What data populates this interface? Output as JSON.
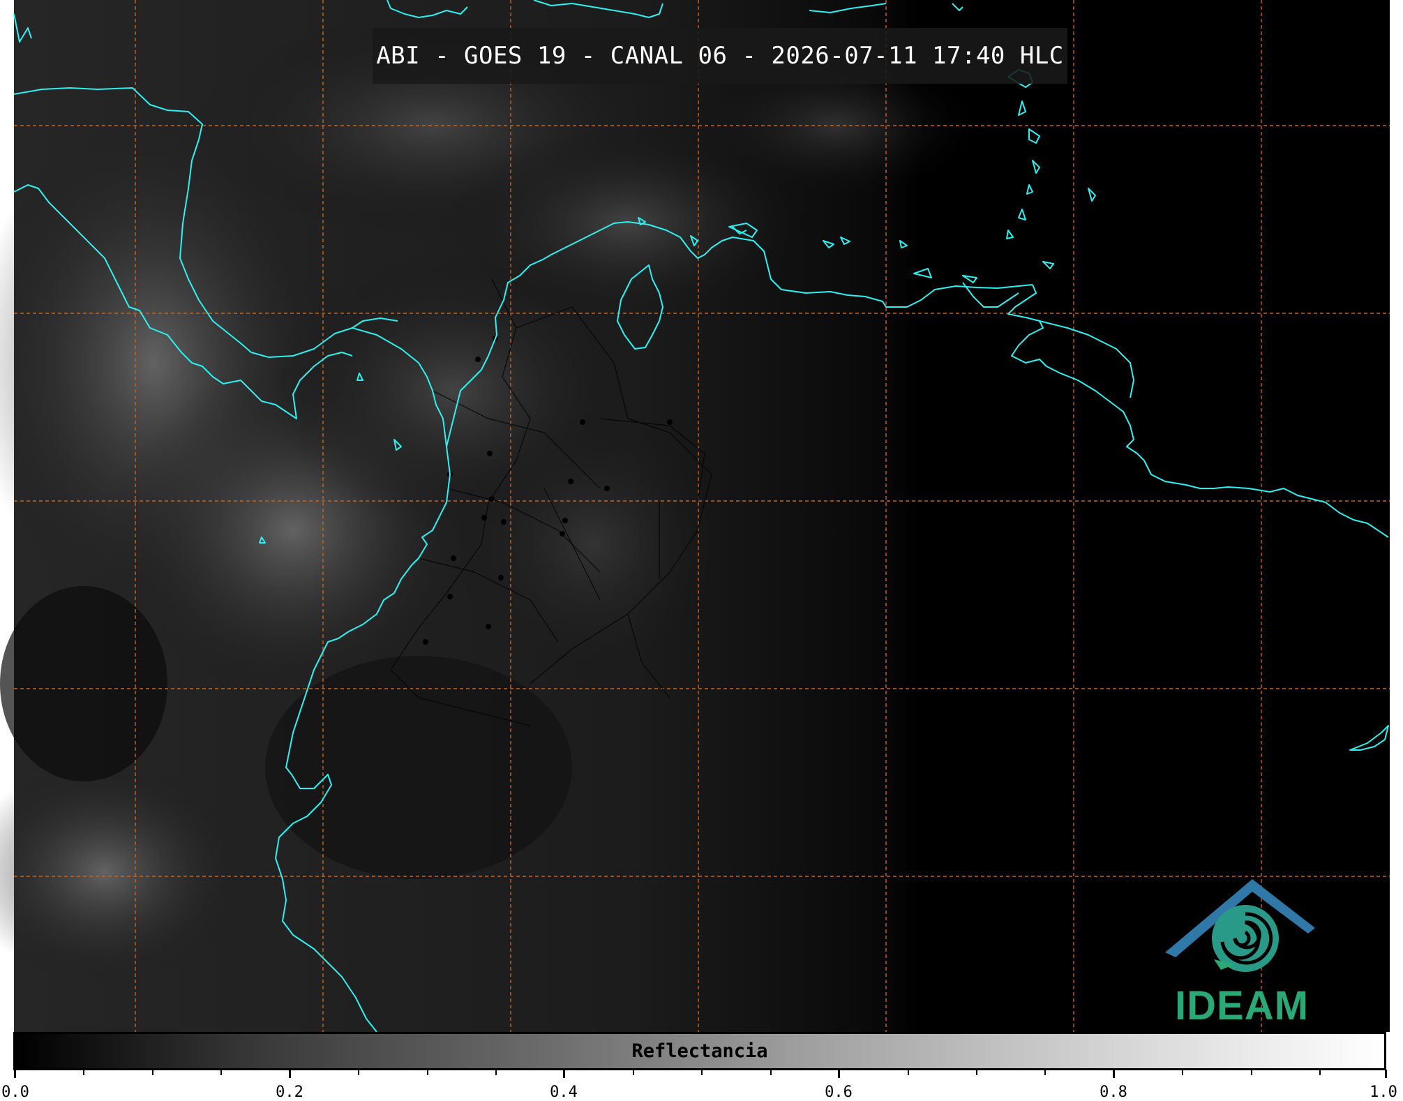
{
  "title": "ABI - GOES 19 - CANAL 06 - 2026-07-11 17:40 HLC",
  "colorbar": {
    "label": "Reflectancia",
    "ticks": [
      "0.0",
      "0.2",
      "0.4",
      "0.6",
      "0.8",
      "1.0"
    ],
    "range": [
      0.0,
      1.0
    ],
    "colormap": "grayscale"
  },
  "logo": {
    "text": "IDEAM"
  },
  "colors": {
    "coastline": "#2ff0f0",
    "gridlines": "#c8641e",
    "background": "#000000"
  }
}
